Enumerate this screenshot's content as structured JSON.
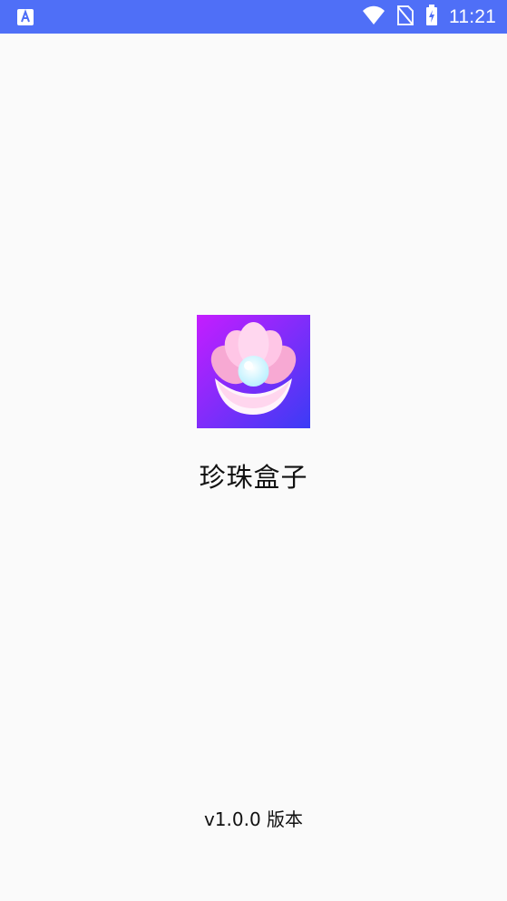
{
  "status_bar": {
    "time": "11:21",
    "icons": [
      "app-notification-icon",
      "wifi-icon",
      "no-sim-icon",
      "battery-charging-icon"
    ]
  },
  "splash": {
    "app_name": "珍珠盒子",
    "version": "v1.0.0 版本",
    "icon": "pearl-shell-logo"
  },
  "colors": {
    "status_bar": "#4f6ff7",
    "background": "#fafafa",
    "logo_gradient_start": "#c51dff",
    "logo_gradient_end": "#3b3cf5",
    "shell_pink": "#f7a9d3",
    "pearl": "#e8fbff"
  }
}
